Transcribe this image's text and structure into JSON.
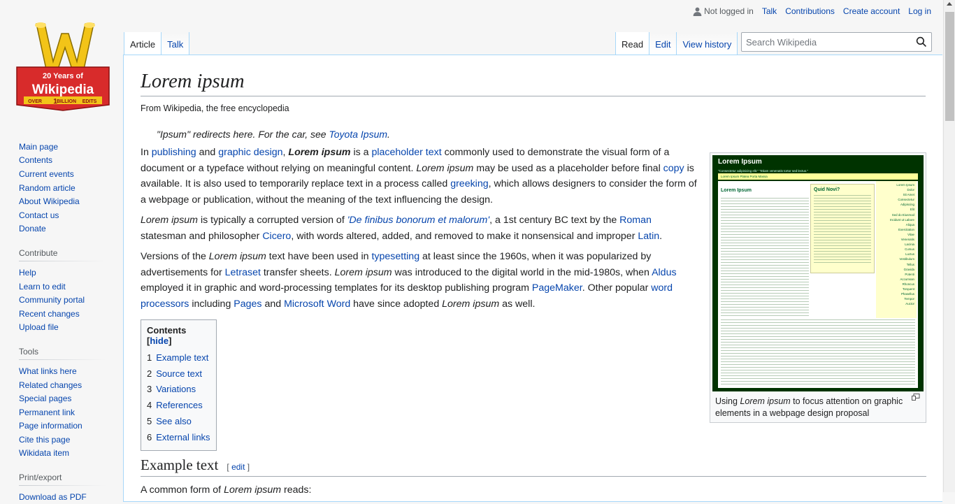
{
  "personal": {
    "not_logged_in": "Not logged in",
    "talk": "Talk",
    "contributions": "Contributions",
    "create_account": "Create account",
    "log_in": "Log in"
  },
  "logo": {
    "line1": "20 Years of",
    "line2": "Wikipedia",
    "line3_over": "OVER",
    "line3_billion": "BILLION",
    "line3_edits": "EDITS",
    "line3_num": "1"
  },
  "sidebar": {
    "nav": [
      "Main page",
      "Contents",
      "Current events",
      "Random article",
      "About Wikipedia",
      "Contact us",
      "Donate"
    ],
    "contribute_heading": "Contribute",
    "contribute": [
      "Help",
      "Learn to edit",
      "Community portal",
      "Recent changes",
      "Upload file"
    ],
    "tools_heading": "Tools",
    "tools": [
      "What links here",
      "Related changes",
      "Special pages",
      "Permanent link",
      "Page information",
      "Cite this page",
      "Wikidata item"
    ],
    "print_heading": "Print/export",
    "print": [
      "Download as PDF"
    ]
  },
  "tabs": {
    "left": [
      "Article",
      "Talk"
    ],
    "right": [
      "Read",
      "Edit",
      "View history"
    ]
  },
  "search": {
    "placeholder": "Search Wikipedia"
  },
  "article": {
    "title": "Lorem ipsum",
    "site_sub": "From Wikipedia, the free encyclopedia",
    "hatnote_pre": "\"Ipsum\" redirects here. For the car, see ",
    "hatnote_link": "Toyota Ipsum",
    "hatnote_post": ".",
    "p1": {
      "t1": "In ",
      "l1": "publishing",
      "t2": " and ",
      "l2": "graphic design",
      "t3": ", ",
      "b1": "Lorem ipsum",
      "t4": " is a ",
      "l3": "placeholder text",
      "t5": " commonly used to demonstrate the visual form of a document or a typeface without relying on meaningful content. ",
      "i1": "Lorem ipsum",
      "t6": " may be used as a placeholder before final ",
      "l4": "copy",
      "t7": " is available. It is also used to temporarily replace text in a process called ",
      "l5": "greeking",
      "t8": ", which allows designers to consider the form of a webpage or publication, without the meaning of the text influencing the design."
    },
    "p2": {
      "i1": "Lorem ipsum",
      "t1": " is typically a corrupted version of ",
      "l1": "'De finibus bonorum et malorum'",
      "t2": ", a 1st century BC text by the ",
      "l2": "Roman",
      "t3": " statesman and philosopher ",
      "l3": "Cicero",
      "t4": ", with words altered, added, and removed to make it nonsensical and improper ",
      "l4": "Latin",
      "t5": "."
    },
    "p3": {
      "t1": "Versions of the ",
      "i1": "Lorem ipsum",
      "t2": " text have been used in ",
      "l1": "typesetting",
      "t3": " at least since the 1960s, when it was popularized by advertisements for ",
      "l2": "Letraset",
      "t4": " transfer sheets. ",
      "i2": "Lorem ipsum",
      "t5": " was introduced to the digital world in the mid-1980s, when ",
      "l3": "Aldus",
      "t6": " employed it in graphic and word-processing templates for its desktop publishing program ",
      "l4": "PageMaker",
      "t7": ". Other popular ",
      "l5": "word processors",
      "t8": " including ",
      "l6": "Pages",
      "t9": " and ",
      "l7": "Microsoft Word",
      "t10": " have since adopted ",
      "i3": "Lorem ipsum",
      "t11": " as well."
    },
    "section_title": "Example text",
    "section_edit": "edit",
    "last_line_pre": "A common form of ",
    "last_line_italic": "Lorem ipsum",
    "last_line_post": " reads:"
  },
  "toc": {
    "title": "Contents",
    "hide": "hide",
    "items": [
      {
        "num": "1",
        "label": "Example text"
      },
      {
        "num": "2",
        "label": "Source text"
      },
      {
        "num": "3",
        "label": "Variations"
      },
      {
        "num": "4",
        "label": "References"
      },
      {
        "num": "5",
        "label": "See also"
      },
      {
        "num": "6",
        "label": "External links"
      }
    ]
  },
  "thumb": {
    "img_title": "Lorem Ipsum",
    "img_quote": "\"Consectetur adipisicing elit.\" \"Etiam venenatis tortor sed lectus.\"",
    "img_nav": "Lorem Ipsum   Platea Porta   Massa",
    "img_main_heading": "Lorem Ipsum",
    "img_box_heading": "Quid Novi?",
    "img_side": [
      "Lorem Ipsum",
      "Dolor",
      "Sit Amet",
      "Consectetur",
      "Adipiscing",
      "Elit",
      "Sed do Eiusmod",
      "Incidunt ut Labore",
      "Aliqua",
      "Exercitation",
      "Vitae",
      "Venenatis",
      "Lacinia",
      "Cursus",
      "Luctus",
      "Vestibulum",
      "Tellus",
      "Gravida",
      "Potenti",
      "Accumsan",
      "Rhoncus",
      "Torquent",
      "Phasellus",
      "Tempor",
      "Auctor"
    ],
    "caption_pre": "Using ",
    "caption_italic": "Lorem ipsum",
    "caption_post": " to focus attention on graphic elements in a webpage design proposal"
  },
  "colors": {
    "link": "#0645ad",
    "border": "#a7d7f9",
    "thumb_bg": "#003300"
  }
}
